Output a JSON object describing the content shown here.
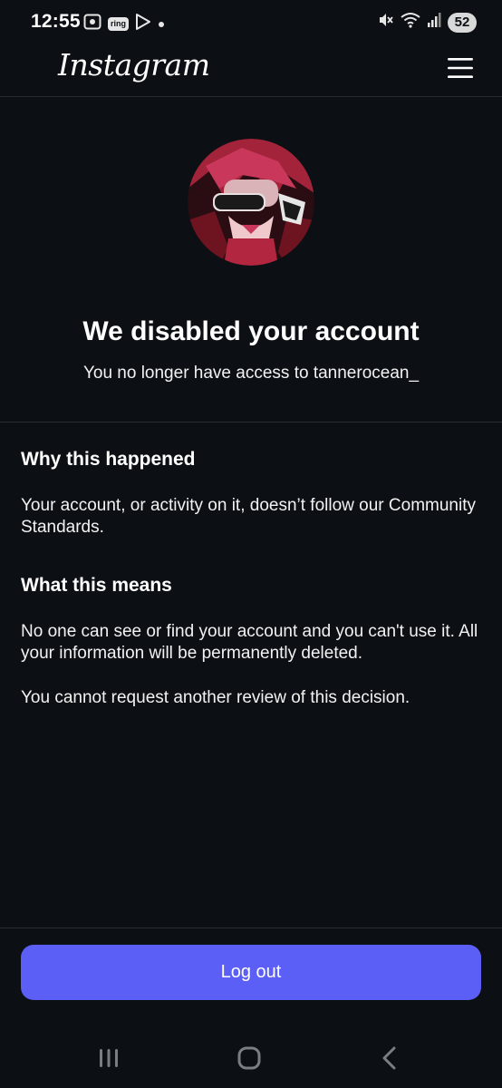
{
  "status_bar": {
    "time": "12:55",
    "ring_label": "ring",
    "battery": "52",
    "icons": [
      "screenshot-icon",
      "ring-app-icon",
      "play-store-icon",
      "notification-dot-icon",
      "mute-icon",
      "wifi-icon",
      "signal-icon",
      "battery-icon"
    ]
  },
  "header": {
    "logo": "Instagram",
    "menu_icon": "hamburger-menu-icon"
  },
  "main": {
    "avatar_icon": "profile-avatar",
    "headline": "We disabled your account",
    "subline": "You no longer have access to tannerocean_"
  },
  "sections": {
    "why_title": "Why this happened",
    "why_text": "Your account, or activity on it, doesn’t follow our Community Standards.",
    "means_title": "What this means",
    "means_text_1": "No one can see or find your account and you can't use it. All your information will be permanently deleted.",
    "means_text_2": "You cannot request another review of this decision."
  },
  "actions": {
    "logout_label": "Log out"
  },
  "nav": {
    "icons": [
      "recent-apps-icon",
      "home-icon",
      "back-icon"
    ]
  },
  "colors": {
    "background": "#0c1014",
    "accent_button": "#5b5ff5",
    "divider": "#2b2f33"
  }
}
